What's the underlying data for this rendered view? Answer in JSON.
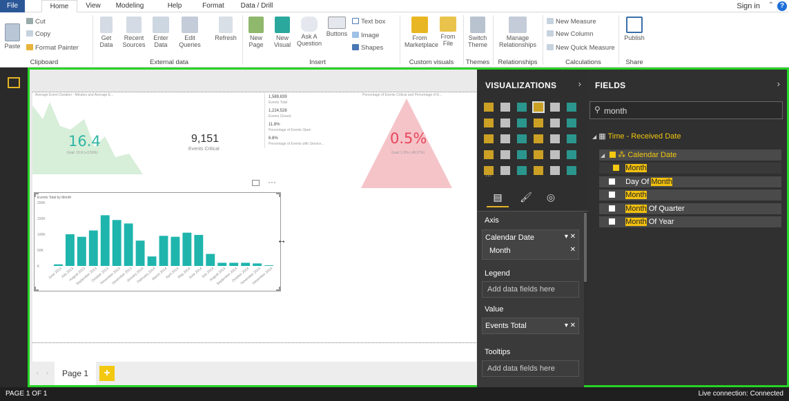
{
  "tabs": [
    "File",
    "Home",
    "View",
    "Modeling",
    "Help",
    "Format",
    "Data / Drill"
  ],
  "signin": "Sign in",
  "clipboard": {
    "paste": "Paste",
    "cut": "Cut",
    "copy": "Copy",
    "format_painter": "Format Painter",
    "group": "Clipboard"
  },
  "external": {
    "get_data": "Get Data",
    "recent": "Recent Sources",
    "enter": "Enter Data",
    "edit": "Edit Queries",
    "refresh": "Refresh",
    "group": "External data"
  },
  "insert": {
    "new_page": "New Page",
    "new_visual": "New Visual",
    "ask": "Ask A Question",
    "buttons": "Buttons",
    "text_box": "Text box",
    "image": "Image",
    "shapes": "Shapes",
    "group": "Insert"
  },
  "custom": {
    "marketplace": "From Marketplace",
    "file": "From File",
    "group": "Custom visuals"
  },
  "themes": {
    "switch": "Switch Theme",
    "group": "Themes"
  },
  "relationships": {
    "manage": "Manage Relationships",
    "group": "Relationships"
  },
  "calc": {
    "measure": "New Measure",
    "column": "New Column",
    "quick": "New Quick Measure",
    "group": "Calculations"
  },
  "share": {
    "publish": "Publish",
    "group": "Share"
  },
  "canvas": {
    "kpi1_title": "Average Event Duration - Minutes and Average E...",
    "kpi1_value": "16.4",
    "kpi1_goal": "Goal: 15.8 (+3.59%)",
    "card_value": "9,151",
    "card_label": "Events Critical",
    "multi": [
      [
        "1,589,839",
        "Events Total"
      ],
      [
        "1,224,528",
        "Events Closed"
      ],
      [
        "11.8%",
        "Percentage of Events Open"
      ],
      [
        "6.8%",
        "Percentage of Events with Service..."
      ]
    ],
    "kpi2_title": "Percentage of Events Critical and Percentage of E...",
    "kpi2_value": "0.5%",
    "kpi2_goal": "Goal: 1.0% (-49.37%)",
    "page_tab": "Page 1"
  },
  "chart_data": {
    "type": "bar",
    "title": "Events Total by Month",
    "categories": [
      "June 2013",
      "July 2013",
      "August 2013",
      "September 2013",
      "October 2013",
      "November 2013",
      "December 2013",
      "January 2014",
      "February 2014",
      "March 2014",
      "April 2014",
      "May 2014",
      "June 2014",
      "July 2014",
      "August 2014",
      "September 2014",
      "October 2014",
      "November 2014",
      "December 2014"
    ],
    "values": [
      5000,
      100000,
      92000,
      112000,
      160000,
      145000,
      134000,
      80000,
      30000,
      95000,
      92000,
      105000,
      98000,
      38000,
      10000,
      10000,
      10000,
      8000,
      2000
    ],
    "yticks": [
      "200K",
      "150K",
      "100K",
      "50K",
      "K"
    ],
    "ylim": [
      0,
      200000
    ],
    "color": "#1fb5ad"
  },
  "visualizations": {
    "title": "VISUALIZATIONS",
    "axis": "Axis",
    "axis_field": "Calendar Date",
    "axis_sub": "Month",
    "legend": "Legend",
    "legend_ph": "Add data fields here",
    "value": "Value",
    "value_field": "Events Total",
    "tooltips": "Tooltips",
    "tooltips_ph": "Add data fields here",
    "more": "..."
  },
  "fields": {
    "title": "FIELDS",
    "search": "month",
    "table": "Time - Received Date",
    "hierarchy": "Calendar Date",
    "month": "Month",
    "dom_pre": "Day Of ",
    "dom_hl": "Month",
    "moq_post": " Of Quarter",
    "moy_post": " Of Year"
  },
  "status": {
    "left": "PAGE 1 OF 1",
    "right": "Live connection: Connected"
  }
}
